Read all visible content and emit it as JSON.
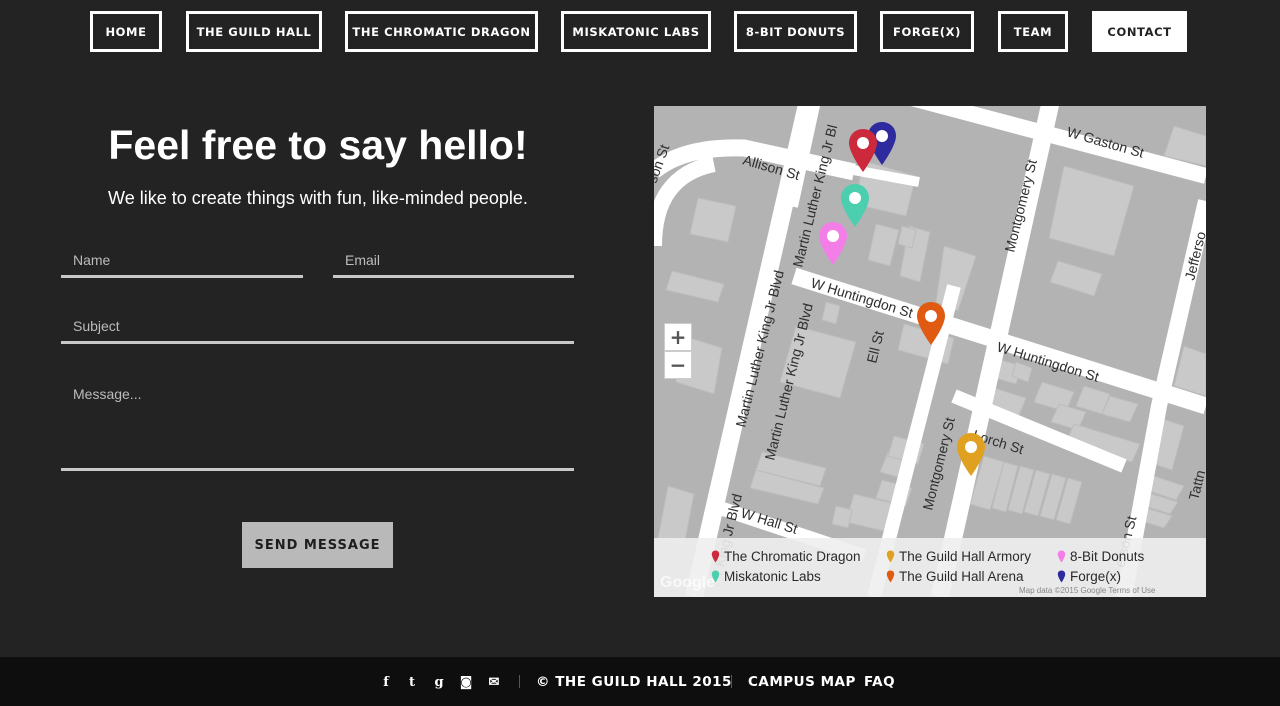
{
  "nav": {
    "items": [
      {
        "label": "HOME"
      },
      {
        "label": "THE GUILD HALL"
      },
      {
        "label": "THE CHROMATIC DRAGON"
      },
      {
        "label": "MISKATONIC LABS"
      },
      {
        "label": "8-BIT DONUTS"
      },
      {
        "label": "FORGE(X)"
      },
      {
        "label": "TEAM"
      },
      {
        "label": "CONTACT",
        "active": true
      }
    ]
  },
  "contact": {
    "headline": "Feel free to say hello!",
    "subline": "We like to create things with fun, like-minded people.",
    "fields": {
      "name": {
        "placeholder": "Name",
        "value": ""
      },
      "email": {
        "placeholder": "Email",
        "value": ""
      },
      "subject": {
        "placeholder": "Subject",
        "value": ""
      },
      "message": {
        "placeholder": "Message...",
        "value": ""
      }
    },
    "send_label": "SEND MESSAGE"
  },
  "map": {
    "streets": {
      "allison": "Allison St",
      "allison_west": "son St",
      "mlk_north": "Martin Luther King Jr Bl",
      "mlk_mid": "Martin Luther King Jr Blvd",
      "mlk_south": "Martin Luther King Jr Blvd",
      "mlk_bottom": "r King Jr Blvd",
      "gaston": "W Gaston St",
      "montgomery_north": "Montgomery St",
      "montgomery_south": "Montgomery St",
      "jefferson": "Jeffersо",
      "huntingdon_west": "W Huntingdon St",
      "huntingdon_east": "W Huntingdon St",
      "ell": "Ell St",
      "lorch": "Lorch St",
      "hall": "W Hall St",
      "jefferson_south": "erson St",
      "tattnall": "Tattn"
    },
    "zoom_in": "+",
    "zoom_out": "−",
    "watermark": "Google",
    "map_data": "Map data ©2015 Google    Terms of Use",
    "colors": {
      "chromatic_dragon": "#cc2a3c",
      "guild_hall_armory": "#e0a020",
      "donuts": "#f47ee8",
      "miskatonic": "#4ccfaf",
      "arena": "#e05a12",
      "forge": "#2e2b9e"
    },
    "legend": [
      {
        "label": "The Chromatic Dragon",
        "color": "#cc2a3c"
      },
      {
        "label": "The Guild Hall Armory",
        "color": "#e0a020"
      },
      {
        "label": "8-Bit Donuts",
        "color": "#f47ee8"
      },
      {
        "label": "Miskatonic Labs",
        "color": "#4ccfaf"
      },
      {
        "label": "The Guild Hall Arena",
        "color": "#e05a12"
      },
      {
        "label": "Forge(x)",
        "color": "#2e2b9e"
      }
    ]
  },
  "footer": {
    "social": [
      {
        "icon": "facebook-icon",
        "glyph": "f"
      },
      {
        "icon": "twitter-icon",
        "glyph": "t"
      },
      {
        "icon": "google-plus-icon",
        "glyph": "g"
      },
      {
        "icon": "instagram-icon",
        "glyph": "◙"
      },
      {
        "icon": "email-icon",
        "glyph": "✉"
      }
    ],
    "copyright": "© THE GUILD HALL 2015",
    "links": [
      {
        "label": "CAMPUS MAP"
      },
      {
        "label": "FAQ"
      }
    ]
  }
}
